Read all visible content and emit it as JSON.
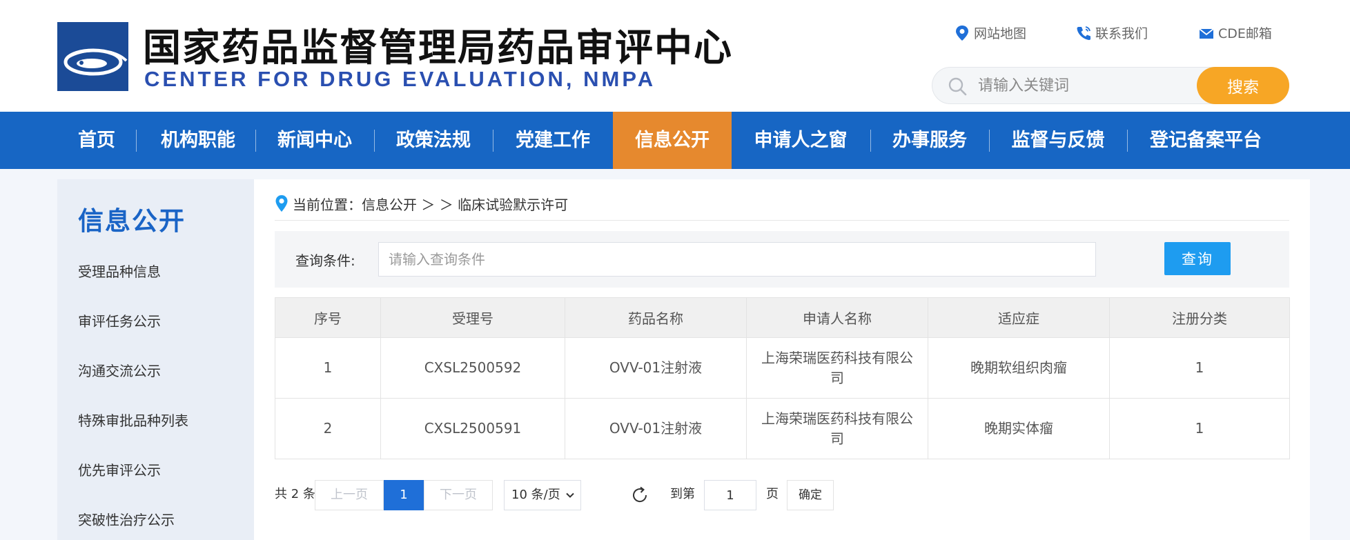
{
  "header": {
    "title_cn": "国家药品监督管理局药品审评中心",
    "title_en": "CENTER FOR DRUG EVALUATION, NMPA",
    "links": [
      {
        "label": "网站地图",
        "icon": "map-pin-icon"
      },
      {
        "label": "联系我们",
        "icon": "phone-icon"
      },
      {
        "label": "CDE邮箱",
        "icon": "mail-icon"
      }
    ],
    "search_placeholder": "请输入关键词",
    "search_button": "搜索"
  },
  "nav": {
    "items": [
      {
        "label": "首页"
      },
      {
        "label": "机构职能"
      },
      {
        "label": "新闻中心"
      },
      {
        "label": "政策法规"
      },
      {
        "label": "党建工作"
      },
      {
        "label": "信息公开",
        "active": true
      },
      {
        "label": "申请人之窗"
      },
      {
        "label": "办事服务"
      },
      {
        "label": "监督与反馈"
      },
      {
        "label": "登记备案平台"
      }
    ]
  },
  "sidebar": {
    "title": "信息公开",
    "items": [
      {
        "label": "受理品种信息"
      },
      {
        "label": "审评任务公示"
      },
      {
        "label": "沟通交流公示"
      },
      {
        "label": "特殊审批品种列表"
      },
      {
        "label": "优先审评公示"
      },
      {
        "label": "突破性治疗公示"
      }
    ]
  },
  "breadcrumb": {
    "text": "当前位置：信息公开 ＞ ＞ 临床试验默示许可"
  },
  "query": {
    "label": "查询条件:",
    "placeholder": "请输入查询条件",
    "button": "查询"
  },
  "table": {
    "headers": [
      "序号",
      "受理号",
      "药品名称",
      "申请人名称",
      "适应症",
      "注册分类"
    ],
    "rows": [
      [
        "1",
        "CXSL2500592",
        "OVV-01注射液",
        "上海荣瑞医药科技有限公司",
        "晚期软组织肉瘤",
        "1"
      ],
      [
        "2",
        "CXSL2500591",
        "OVV-01注射液",
        "上海荣瑞医药科技有限公司",
        "晚期实体瘤",
        "1"
      ]
    ]
  },
  "pager": {
    "total": "共 2 条",
    "prev": "上一页",
    "current": "1",
    "next": "下一页",
    "page_size": "10 条/页",
    "goto_label": "到第",
    "goto_value": "1",
    "page_unit": "页",
    "confirm": "确定"
  },
  "colors": {
    "nav_bg": "#1766c4",
    "nav_active": "#e6892e",
    "search_button": "#f7a625",
    "query_button": "#1e9cf0",
    "sidebar_title": "#1a64c6"
  }
}
